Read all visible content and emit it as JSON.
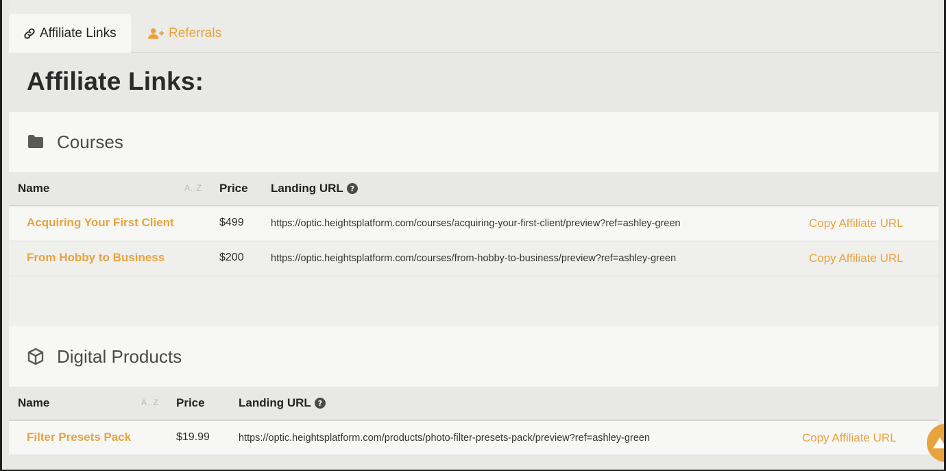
{
  "tabs": [
    {
      "label": "Affiliate Links",
      "icon": "link-icon",
      "active": true
    },
    {
      "label": "Referrals",
      "icon": "user-plus-icon",
      "active": false
    }
  ],
  "page_title": "Affiliate Links:",
  "colors": {
    "accent": "#e8a33d",
    "text": "#2d2d2d",
    "muted": "#b7b7b3"
  },
  "sections": [
    {
      "title": "Courses",
      "icon": "folder-icon",
      "columns": {
        "name": "Name",
        "sort": "A..Z",
        "price": "Price",
        "landing_url": "Landing URL"
      },
      "rows": [
        {
          "name": "Acquiring Your First Client",
          "price": "$499",
          "url": "https://optic.heightsplatform.com/courses/acquiring-your-first-client/preview?ref=ashley-green",
          "action": "Copy Affiliate URL"
        },
        {
          "name": "From Hobby to Business",
          "price": "$200",
          "url": "https://optic.heightsplatform.com/courses/from-hobby-to-business/preview?ref=ashley-green",
          "action": "Copy Affiliate URL"
        }
      ]
    },
    {
      "title": "Digital Products",
      "icon": "cube-icon",
      "columns": {
        "name": "Name",
        "sort": "A..Z",
        "price": "Price",
        "landing_url": "Landing URL"
      },
      "rows": [
        {
          "name": "Filter Presets Pack",
          "price": "$19.99",
          "url": "https://optic.heightsplatform.com/products/photo-filter-presets-pack/preview?ref=ashley-green",
          "action": "Copy Affiliate URL"
        }
      ]
    }
  ]
}
